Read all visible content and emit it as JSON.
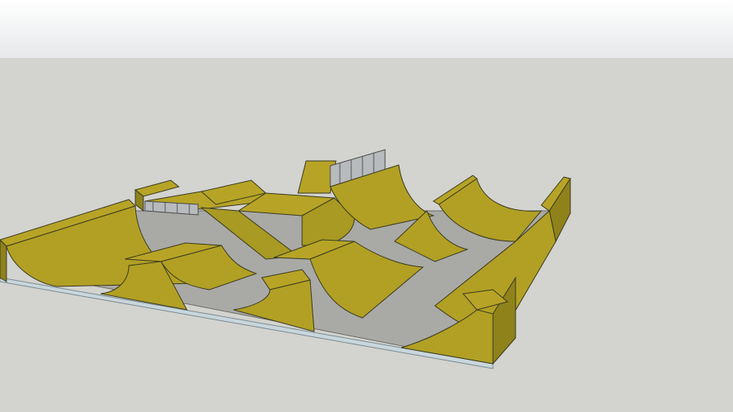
{
  "scene": {
    "description_type": "3d-skatepark-model-render",
    "colors": {
      "sky_top": "#ffffff",
      "sky_bottom": "#e6e8ea",
      "ground": "#d3d3cf",
      "ramp": "#b7a426",
      "floor": "#a9a9a6"
    }
  }
}
